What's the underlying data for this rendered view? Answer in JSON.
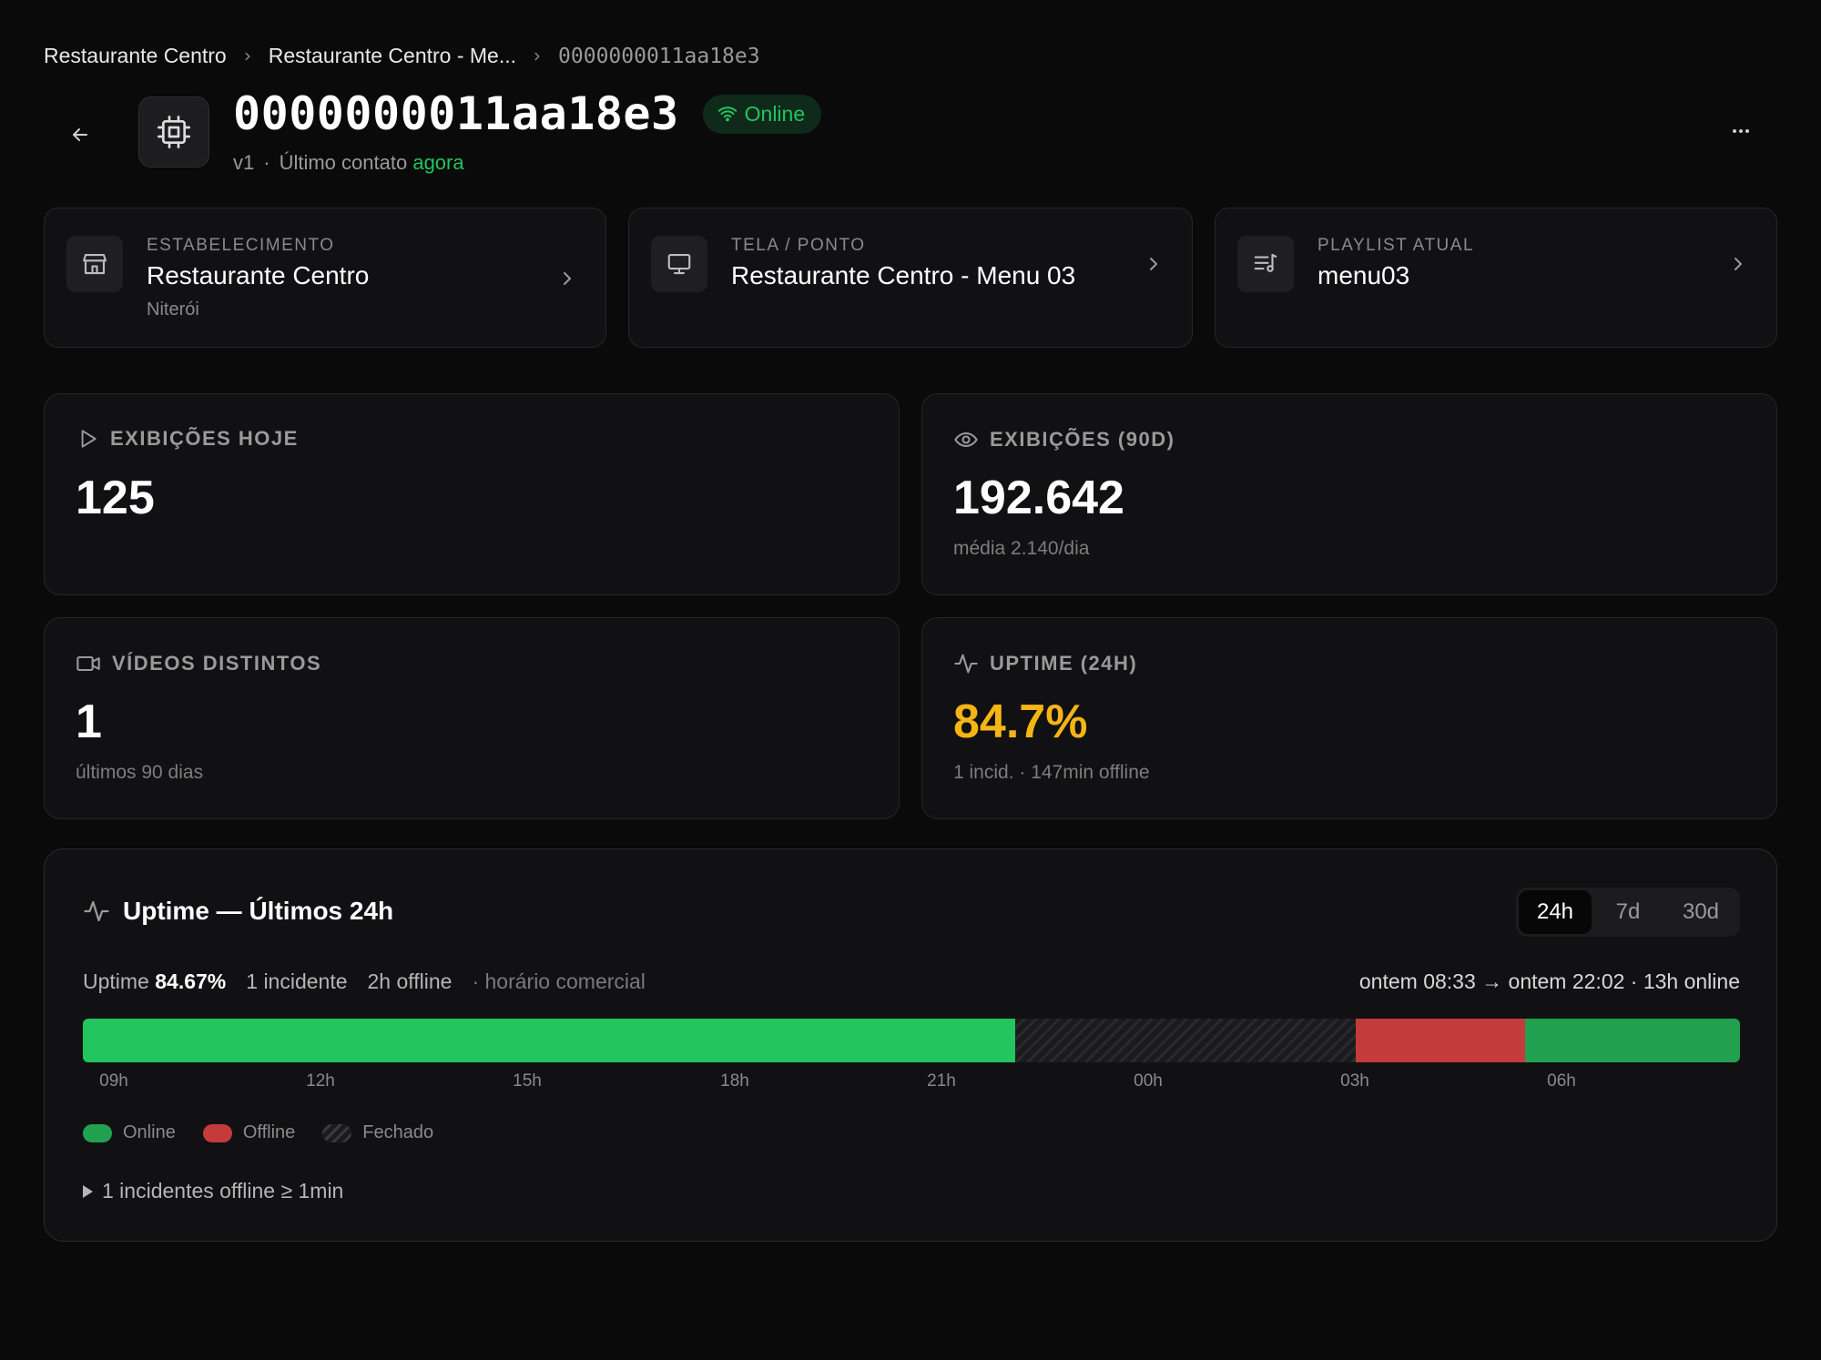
{
  "breadcrumb": {
    "items": [
      "Restaurante Centro",
      "Restaurante Centro - Me...",
      "0000000011aa18e3"
    ]
  },
  "header": {
    "title": "0000000011aa18e3",
    "status": "Online",
    "version": "v1",
    "dot": "·",
    "last_contact_label": "Último contato",
    "last_contact_value": "agora",
    "more_label": "..."
  },
  "info_cards": [
    {
      "label": "ESTABELECIMENTO",
      "value": "Restaurante Centro",
      "sub": "Niterói",
      "icon": "store-icon"
    },
    {
      "label": "TELA / PONTO",
      "value": "Restaurante Centro - Menu 03",
      "icon": "monitor-icon"
    },
    {
      "label": "PLAYLIST ATUAL",
      "value": "menu03",
      "icon": "playlist-icon"
    }
  ],
  "stats": {
    "views_today": {
      "label": "EXIBIÇÕES HOJE",
      "value": "125",
      "icon": "play-icon"
    },
    "views_90d": {
      "label": "EXIBIÇÕES (90D)",
      "value": "192.642",
      "sub": "média 2.140/dia",
      "icon": "eye-icon"
    },
    "distinct_videos": {
      "label": "VÍDEOS DISTINTOS",
      "value": "1",
      "sub": "últimos 90 dias",
      "icon": "video-icon"
    },
    "uptime": {
      "label": "UPTIME (24H)",
      "value": "84.7%",
      "sub": "1 incid. · 147min offline",
      "icon": "activity-icon",
      "color": "#f5b514"
    }
  },
  "uptime_panel": {
    "title": "Uptime — Últimos 24h",
    "ranges": [
      "24h",
      "7d",
      "30d"
    ],
    "active_range": "24h",
    "uptime_label": "Uptime",
    "uptime_value": "84.67%",
    "incidents": "1 incidente",
    "offline": "2h offline",
    "business_hours": "· horário comercial",
    "window": "ontem 08:33 → ontem 22:02 · 13h online",
    "ticks": [
      "09h",
      "12h",
      "15h",
      "18h",
      "21h",
      "00h",
      "03h",
      "06h"
    ],
    "legend": {
      "online": "Online",
      "offline": "Offline",
      "closed": "Fechado"
    },
    "incidents_toggle": "1 incidentes offline ≥ 1min",
    "colors": {
      "online": "#22c55e",
      "offline": "#c43b3b",
      "accent_green": "#22c55e",
      "amber": "#f5b514"
    }
  }
}
